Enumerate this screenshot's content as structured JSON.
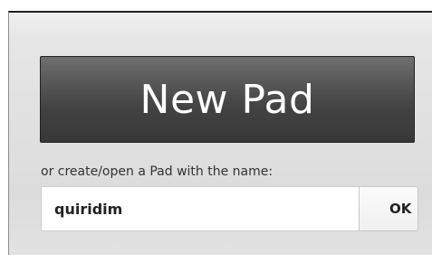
{
  "new_pad_button": {
    "label": "New Pad"
  },
  "open_pad": {
    "prompt": "or create/open a Pad with the name:",
    "input_value": "quiridim",
    "ok_label": "OK"
  }
}
